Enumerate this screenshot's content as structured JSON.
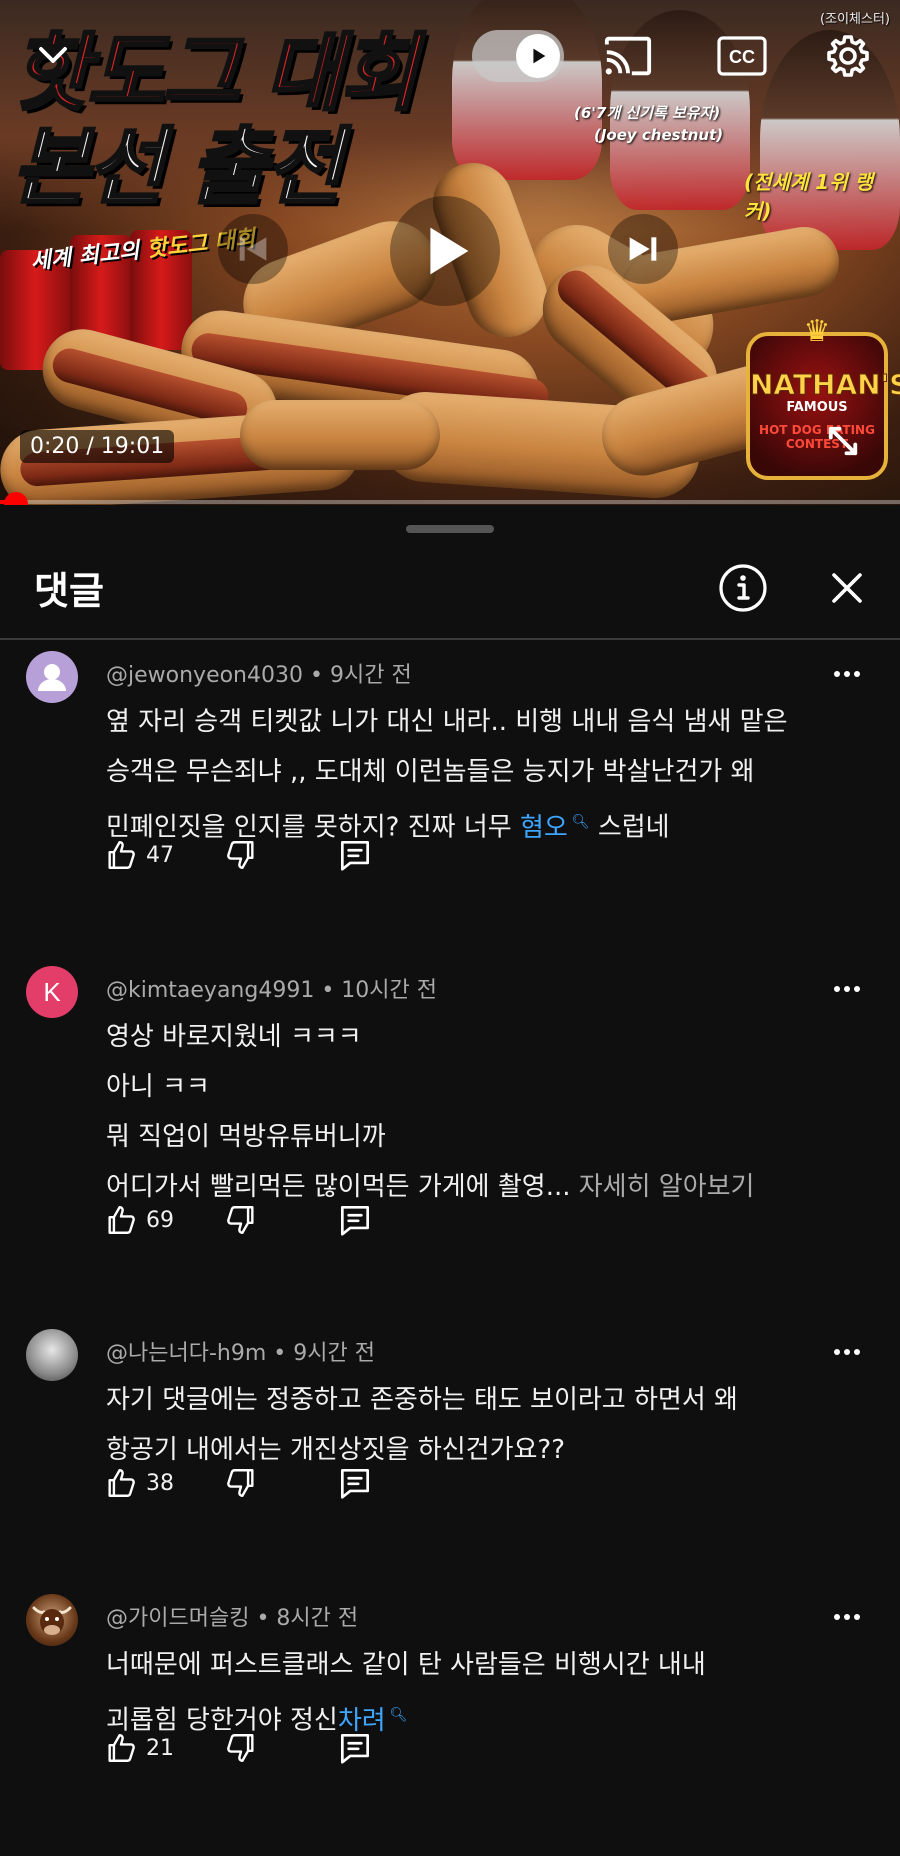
{
  "player": {
    "thumbnail": {
      "title_line1": "핫도그 대회",
      "title_line2": "본선 출전",
      "subtitle_prefix": "세계 최고의 ",
      "subtitle_highlight": "핫도그 대회",
      "caption_record": "(6'7개 신기록 보유자)",
      "caption_name": "(Joey chestnut)",
      "caption_rank": "(전세계 1위 랭커)",
      "channel_watermark": "(조이체스터)",
      "badge_line1": "NATHAN'S",
      "badge_line2": "FAMOUS",
      "badge_line3": "HOT DOG EATING",
      "badge_line4": "CONTEST"
    },
    "time_display": "0:20 / 19:01",
    "progress_fraction": 0.0175,
    "icons": {
      "collapse": "chevron-down-icon",
      "autoplay": "autoplay-toggle-icon",
      "cast": "cast-icon",
      "captions": "cc-icon",
      "settings": "gear-icon",
      "previous": "previous-icon",
      "play": "play-icon",
      "next": "next-icon",
      "fullscreen": "fullscreen-icon"
    },
    "captions_label": "CC"
  },
  "comments_panel": {
    "title": "댓글",
    "comments": [
      {
        "author": "@jewonyeon4030",
        "time": "9시간 전",
        "lines": [
          "옆 자리 승객 티켓값 니가 대신 내라.. 비행 내내 음식 냄새 맡은",
          "승객은 무슨죄냐 ,, 도대체 이런놈들은 능지가 박살난건가 왜"
        ],
        "line3_prefix": "민폐인짓을 인지를 못하지? 진짜 너무 ",
        "line3_link": "혐오",
        "line3_suffix": " 스럽네",
        "likes": "47"
      },
      {
        "author": "@kimtaeyang4991",
        "avatar_letter": "K",
        "time": "10시간 전",
        "lines": [
          "영상 바로지웠네 ㅋㅋㅋ",
          "아니 ㅋㅋ",
          "뭐 직업이 먹방유튜버니까"
        ],
        "line4_prefix": "어디가서 빨리먹든 많이먹든 가게에 촬영... ",
        "read_more": "자세히 알아보기",
        "likes": "69"
      },
      {
        "author": "@나는너다-h9m",
        "time": "9시간 전",
        "lines": [
          "자기 댓글에는 정중하고 존중하는 태도 보이라고 하면서 왜",
          "항공기 내에서는 개진상짓을 하신건가요??"
        ],
        "likes": "38"
      },
      {
        "author": "@가이드머슬킹",
        "time": "8시간 전",
        "lines": [
          "너때문에 퍼스트클래스 같이 탄 사람들은 비행시간 내내"
        ],
        "line2_prefix": "괴롭힘 당한거야 정신",
        "line2_link": "차려",
        "likes": "21"
      }
    ]
  }
}
